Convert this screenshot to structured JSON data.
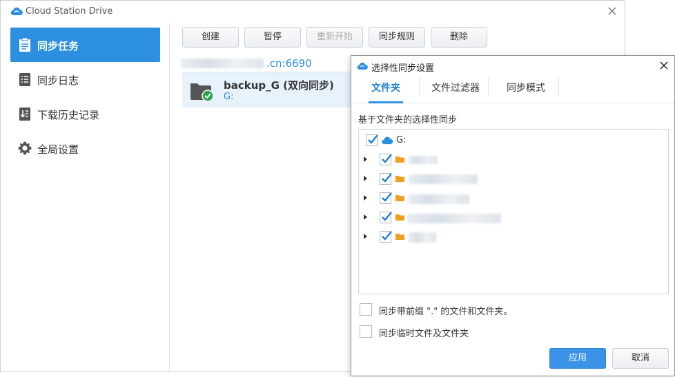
{
  "window": {
    "title": "Cloud Station Drive"
  },
  "sidebar": {
    "items": [
      {
        "label": "同步任务",
        "icon": "clipboard-icon"
      },
      {
        "label": "同步日志",
        "icon": "list-icon"
      },
      {
        "label": "下载历史记录",
        "icon": "download-history-icon"
      },
      {
        "label": "全局设置",
        "icon": "gear-icon"
      }
    ]
  },
  "toolbar": {
    "create": "创建",
    "pause": "暂停",
    "restart": "重新开始",
    "rules": "同步规则",
    "delete": "删除"
  },
  "server": {
    "suffix": ".cn:6690"
  },
  "task": {
    "name": "backup_G (双向同步)",
    "path": "G:"
  },
  "dialog": {
    "title": "选择性同步设置",
    "tabs": [
      "文件夹",
      "文件过滤器",
      "同步模式"
    ],
    "section_label": "基于文件夹的选择性同步",
    "root_label": "G:",
    "options": [
      "同步带前缀 \".\" 的文件和文件夹。",
      "同步临时文件及文件夹"
    ],
    "apply": "应用",
    "cancel": "取消"
  },
  "colors": {
    "accent": "#2d8fe0",
    "folder": "#f0a020",
    "success": "#2ea44f"
  }
}
